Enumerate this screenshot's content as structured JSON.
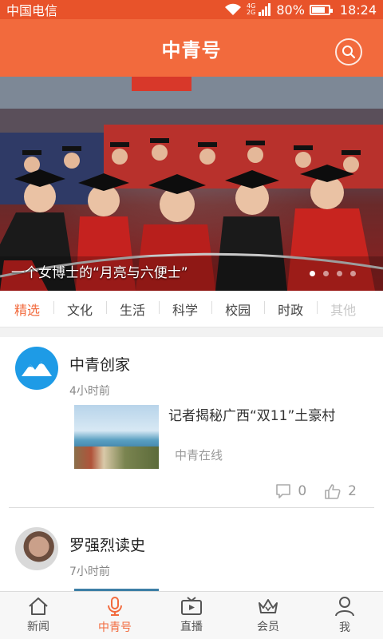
{
  "status_bar": {
    "carrier": "中国电信",
    "network_top": "4G",
    "network_bottom": "2G",
    "battery_text": "80%",
    "battery_level": 0.8,
    "time": "18:24",
    "icons": [
      "wifi-icon",
      "signal-icon",
      "battery-icon"
    ]
  },
  "header": {
    "title": "中青号",
    "search_icon": "search-icon"
  },
  "banner": {
    "caption": "一个女博士的“月亮与六便士”",
    "slide_count": 4,
    "active_slide": 1
  },
  "tabs": [
    {
      "label": "精选",
      "active": true
    },
    {
      "label": "文化"
    },
    {
      "label": "生活"
    },
    {
      "label": "科学"
    },
    {
      "label": "校园"
    },
    {
      "label": "时政"
    },
    {
      "label": "其他",
      "faded": true
    }
  ],
  "feed": [
    {
      "author": "中青创家",
      "time": "4小时前",
      "headline": "记者揭秘广西“双11”土豪村",
      "source": "中青在线",
      "comments": "0",
      "likes": "2"
    },
    {
      "author": "罗强烈读史",
      "time": "7小时前"
    }
  ],
  "bottom_nav": [
    {
      "label": "新闻",
      "icon": "home-icon"
    },
    {
      "label": "中青号",
      "icon": "microphone-icon",
      "active": true
    },
    {
      "label": "直播",
      "icon": "tv-icon"
    },
    {
      "label": "会员",
      "icon": "crown-icon"
    },
    {
      "label": "我",
      "icon": "user-icon"
    }
  ],
  "colors": {
    "accent": "#f26a3d",
    "status_bar": "#e8532a",
    "avatar_blue": "#1e9be6"
  }
}
